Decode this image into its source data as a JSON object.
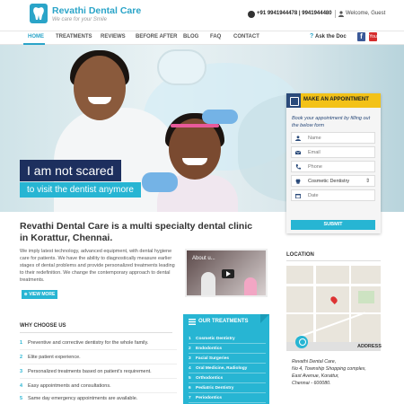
{
  "brand": {
    "name": "Revathi Dental Care",
    "tagline": "We care for your Smile",
    "phone": "+91 9941944478 | 9941944480",
    "welcome": "Welcome, Guest"
  },
  "nav": {
    "items": [
      "HOME",
      "TREATMENTS",
      "REVIEWS",
      "BEFORE AFTER",
      "BLOG",
      "FAQ",
      "CONTACT"
    ],
    "active": "HOME",
    "ask_doc": "Ask the Doc",
    "ask_mark": "?",
    "facebook": "f",
    "youtube": "You"
  },
  "hero": {
    "line1": "I am not scared",
    "line2": "to visit the dentist anymore"
  },
  "appointment": {
    "title": "MAKE AN APPOINTMENT",
    "description": "Book your appointment by filling out the below form",
    "name_placeholder": "Name",
    "email_placeholder": "Email",
    "phone_placeholder": "Phone",
    "treatment_selected": "Cosmetic Dentistry",
    "date_placeholder": "Date",
    "submit_label": "SUBMIT"
  },
  "intro": {
    "title": "Revathi Dental Care is a multi specialty dental clinic in Korattur, Chennai.",
    "body": "We imply latest technology, advanced equipment, with dental hygiene care for patients. We have the ability to diagnostically measure earlier stages of dental problems and provide personalized treatments leading to their redefinition. We change the contemporary approach to dental treatments.",
    "view_more": "VIEW MORE"
  },
  "video": {
    "label": "About u..."
  },
  "location": {
    "title": "LOCATION",
    "address_label": "ADDRESS",
    "address_lines": [
      "Revathi Dental Care,",
      "No 4, Township Shopping complex,",
      "East Avenue, Korattur,",
      "Chennai - 600080."
    ]
  },
  "why": {
    "title": "WHY CHOOSE US",
    "items": [
      "Preventive and corrective dentistry for the whole family.",
      "Elite patient experience.",
      "Personalized treatments based on patient's requirement.",
      "Easy appointments and consultations.",
      "Same day emergency appointments are available."
    ]
  },
  "treatments": {
    "title": "OUR TREATMENTS",
    "items": [
      "Cosmetic Dentistry",
      "Endodontics",
      "Facial Surgeries",
      "Oral Medicine, Radiology",
      "Orthodontics",
      "Pediatric Dentistry",
      "Periodontics"
    ]
  },
  "colors": {
    "accent": "#27b5d3",
    "navy": "#1d2f5e",
    "yellow": "#f3c218"
  },
  "icons": {
    "phone": "phone-icon",
    "user": "user-icon",
    "facebook": "facebook-icon",
    "youtube": "youtube-icon",
    "calendar": "calendar-icon",
    "play": "play-icon",
    "map-pin": "map-pin-icon"
  }
}
